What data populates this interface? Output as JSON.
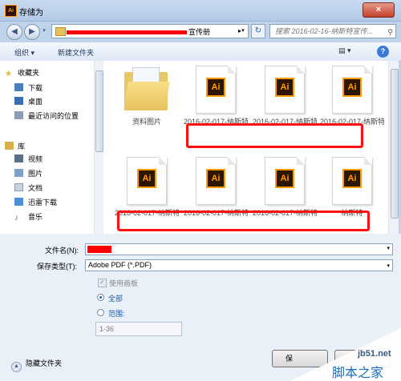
{
  "window": {
    "title": "存储为",
    "app_icon_text": "Ai",
    "close_glyph": "×"
  },
  "nav": {
    "back_glyph": "◀",
    "forward_glyph": "▶",
    "address_crumb": "宣传册",
    "address_arrow": "▸",
    "dropdown_glyph": "▾",
    "refresh_glyph": "↻",
    "search_placeholder": "搜索 2016-02-16-纳斯特宣传...",
    "search_icon_glyph": "⚲"
  },
  "toolbar": {
    "organize": "组织 ▾",
    "new_folder": "新建文件夹",
    "view_glyph": "▤ ▾",
    "help_glyph": "?"
  },
  "sidebar": {
    "favorites": "收藏夹",
    "favorite_items": [
      "下载",
      "桌面",
      "最近访问的位置"
    ],
    "library": "库",
    "library_items": [
      "视频",
      "图片",
      "文档",
      "迅雷下载",
      "音乐"
    ]
  },
  "files": [
    {
      "name": "资料图片",
      "kind": "folder"
    },
    {
      "name": "2016-02-017-纳斯特宣册",
      "kind": "ai"
    },
    {
      "name": "2016-02-017-纳斯特宣册 - 00",
      "kind": "ai"
    },
    {
      "name": "2016-02-017-纳斯特宣册-002",
      "kind": "ai"
    },
    {
      "name": "2016-02-017-纳斯特宣册-003",
      "kind": "ai"
    },
    {
      "name": "2016-02-017-纳斯特宣册004",
      "kind": "ai"
    },
    {
      "name": "2016-02-017-纳斯特宣册 文件展",
      "kind": "ai"
    },
    {
      "name": "纳斯特",
      "kind": "ai"
    }
  ],
  "ai_label": "Ai",
  "form": {
    "filename_label": "文件名(N):",
    "filetype_label": "保存类型(T):",
    "filetype_value": "Adobe PDF (*.PDF)",
    "dropdown_glyph": "▾",
    "use_artboards": "使用画板",
    "all": "全部",
    "range": "范围:",
    "range_value": "1-36",
    "check_glyph": "✓",
    "hide_folders": "隐藏文件夹",
    "hide_glyph": "▲",
    "save": "保"
  },
  "watermark": {
    "line1": "jb51.net",
    "line2": "脚本之家"
  }
}
